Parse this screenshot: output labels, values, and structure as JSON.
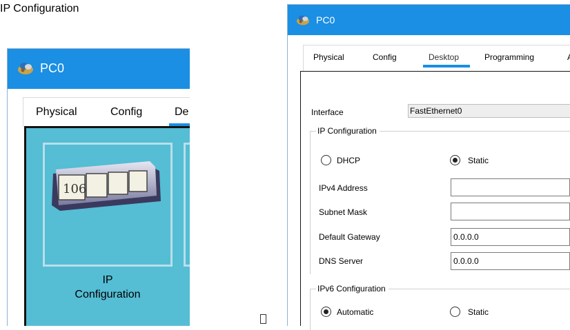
{
  "left_window": {
    "title": "PC0",
    "tabs": [
      {
        "label": "Physical"
      },
      {
        "label": "Config"
      },
      {
        "label": "De"
      }
    ],
    "desktop": {
      "app_counter": "106",
      "app_label_line1": "IP",
      "app_label_line2": "Configuration"
    }
  },
  "right_window": {
    "title": "PC0",
    "tabs": [
      {
        "label": "Physical"
      },
      {
        "label": "Config"
      },
      {
        "label": "Desktop"
      },
      {
        "label": "Programming"
      },
      {
        "label": "A"
      }
    ],
    "ip_configuration_header": "IP Configuration",
    "interface_label": "Interface",
    "interface_value": "FastEthernet0",
    "ipv4_group": {
      "legend": "IP Configuration",
      "dhcp_label": "DHCP",
      "static_label": "Static",
      "selected": "static",
      "fields": {
        "ipv4_address": {
          "label": "IPv4 Address",
          "value": ""
        },
        "subnet_mask": {
          "label": "Subnet Mask",
          "value": ""
        },
        "default_gateway": {
          "label": "Default Gateway",
          "value": "0.0.0.0"
        },
        "dns_server": {
          "label": "DNS Server",
          "value": "0.0.0.0"
        }
      }
    },
    "ipv6_group": {
      "legend": "IPv6 Configuration",
      "automatic_label": "Automatic",
      "static_label": "Static",
      "selected": "automatic"
    }
  },
  "colors": {
    "titlebar": "#1a8fe3",
    "tab_underline": "#1a8fe3",
    "desktop_bg": "#55bdd4",
    "ip_header_bg": "#0000ff"
  },
  "icons": {
    "app_logo": "pc-logo-icon",
    "ip_app": "ip-config-app-icon"
  }
}
